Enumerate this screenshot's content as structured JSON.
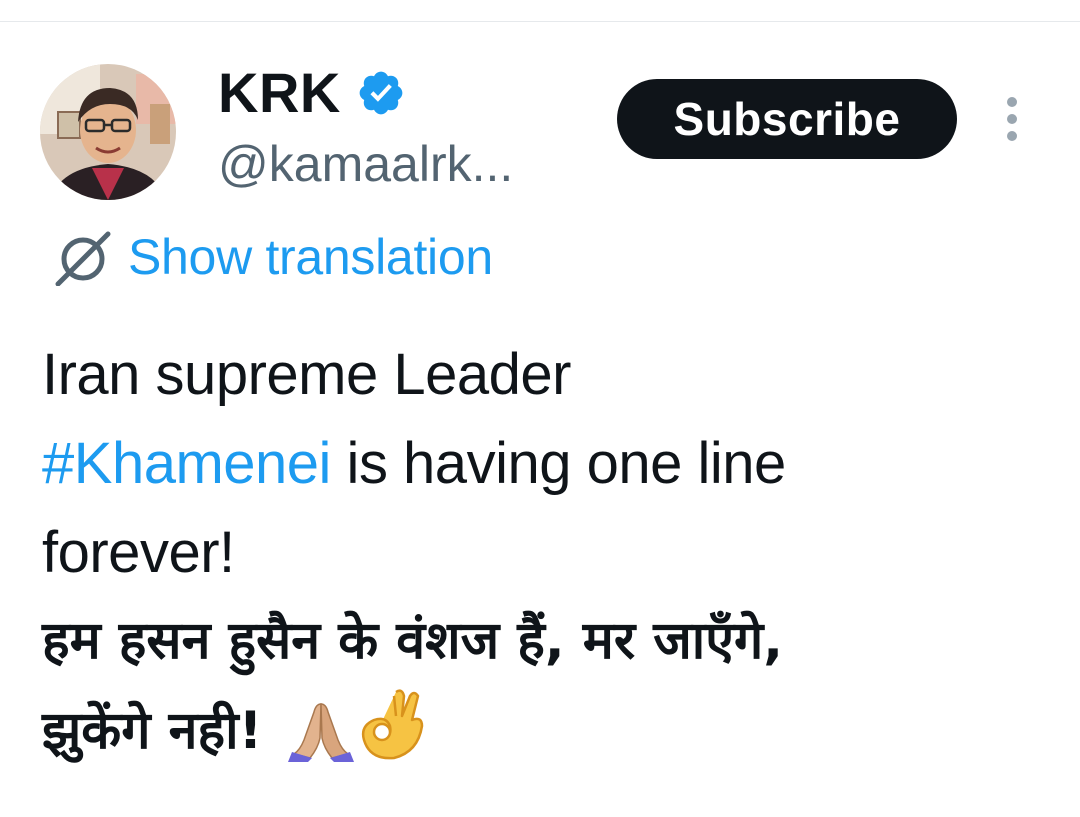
{
  "author": {
    "display_name": "KRK",
    "handle": "@kamaalrk...",
    "verified": true,
    "verified_color": "#1d9bf0"
  },
  "actions": {
    "subscribe_label": "Subscribe"
  },
  "translation": {
    "label": "Show translation"
  },
  "tweet": {
    "line1": "Iran supreme Leader",
    "hashtag": "#Khamenei",
    "line2_rest": " is having one line",
    "line3": "forever!",
    "line4": "हम हसन हुसैन के वंशज हैं, मर जाएँगे,",
    "line5": "झुकेंगे नही!",
    "emojis": [
      "folded-hands-emoji",
      "ok-hand-emoji"
    ]
  },
  "colors": {
    "text": "#0f1419",
    "secondary": "#536471",
    "link": "#1d9bf0",
    "button_bg": "#0f1419",
    "button_text": "#ffffff"
  }
}
